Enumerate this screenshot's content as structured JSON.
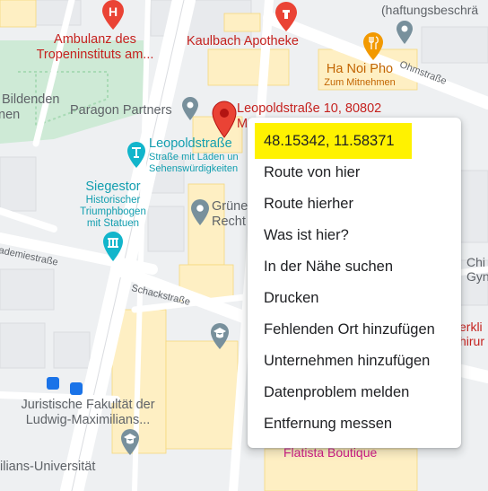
{
  "pin": {
    "label_line1": "Leopoldstraße 10, 80802",
    "label_line2": "M"
  },
  "places": {
    "ambulanz": {
      "line1": "Ambulanz des",
      "line2": "Tropeninstituts am..."
    },
    "kaulbach": "Kaulbach Apotheke",
    "hanoi": {
      "name": "Ha Noi Pho",
      "sub": "Zum Mitnehmen"
    },
    "haftung": "(haftungsbeschrä",
    "bildenden": {
      "line1": "Bildenden",
      "line2": "nen"
    },
    "paragon": "Paragon Partners",
    "leopoldstrasse": {
      "name": "Leopoldstraße",
      "sub1": "Straße mit Läden un",
      "sub2": "Sehenswürdigkeiten"
    },
    "siegestor": {
      "name": "Siegestor",
      "sub1": "Historischer",
      "sub2": "Triumphbogen",
      "sub3": "mit Statuen"
    },
    "gruene": {
      "line1": "Grüne",
      "line2": "Recht"
    },
    "juristische": {
      "line1": "Juristische Fakultät der",
      "line2": "Ludwig-Maximilians..."
    },
    "lmu": "ilians-Universität",
    "flatista": "Flatista Boutique",
    "chi": {
      "line1": "Chi",
      "line2": "Gyn"
    },
    "kli": {
      "line1": "erkli",
      "line2": "hirur"
    }
  },
  "streets": {
    "ohmstrasse": "Ohmstraße",
    "akademie": "ademiestraße",
    "schack": "Schackstraße"
  },
  "context_menu": {
    "coordinates": "48.15342, 11.58371",
    "items": [
      "Route von hier",
      "Route hierher",
      "Was ist hier?",
      "In der Nähe suchen",
      "Drucken",
      "Fehlenden Ort hinzufügen",
      "Unternehmen hinzufügen",
      "Datenproblem melden",
      "Entfernung messen"
    ]
  },
  "colors": {
    "highlight": "#fff200",
    "pin": "#ea4335",
    "park": "#ceead6",
    "building": "#feefc3",
    "road": "#ffffff"
  }
}
